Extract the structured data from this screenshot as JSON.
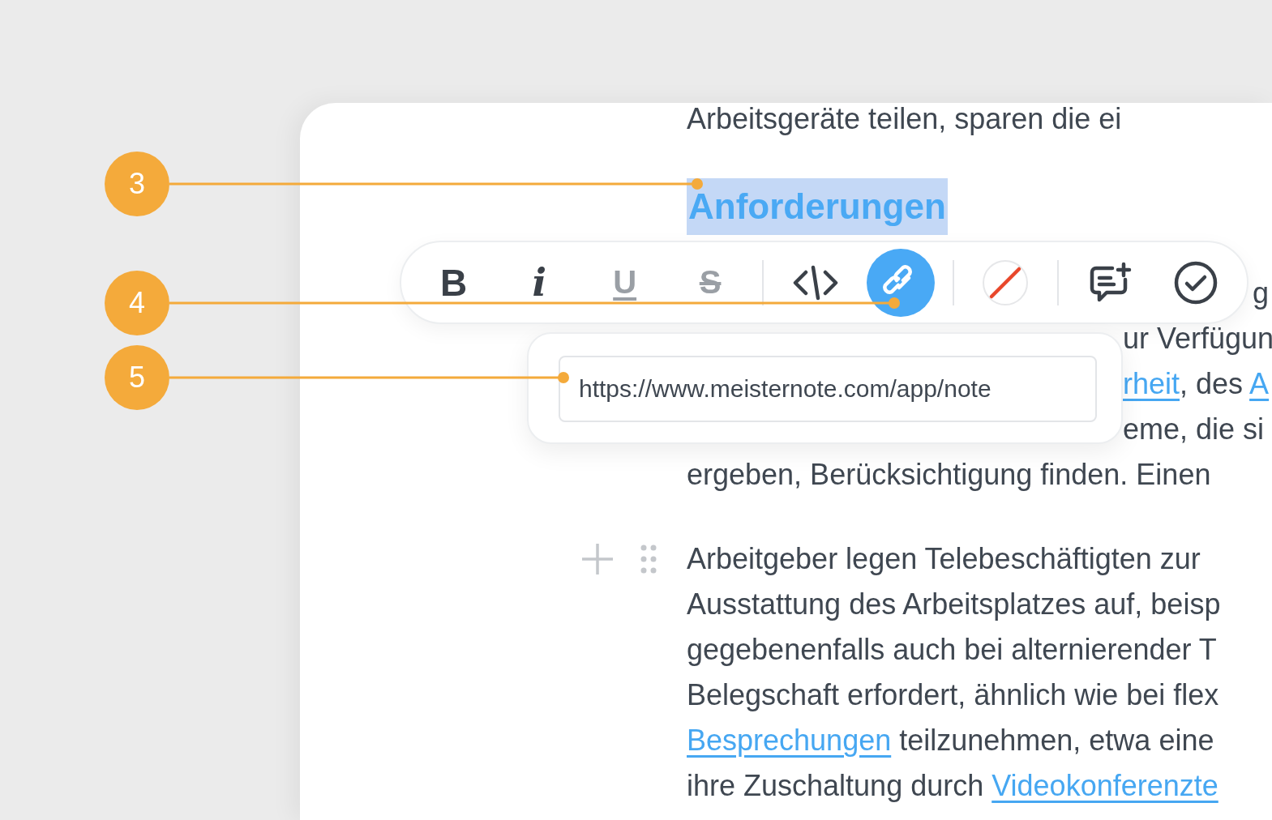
{
  "annotations": [
    {
      "number": "3"
    },
    {
      "number": "4"
    },
    {
      "number": "5"
    }
  ],
  "document": {
    "top_line": "Arbeitsgeräte teilen, sparen die ei",
    "heading": {
      "text": "Anforderungen",
      "selected": true
    },
    "paragraphs": [
      {
        "block_controls": false,
        "lines": [
          {
            "kind": "after-toolbar",
            "segments": [
              {
                "text": "g",
                "link": false
              }
            ]
          },
          {
            "kind": "after-popup",
            "segments": [
              {
                "text": "ur Verfügun",
                "link": false
              }
            ]
          },
          {
            "kind": "after-popup",
            "segments": [
              {
                "text": "rheit",
                "link": true
              },
              {
                "text": ", des ",
                "link": false
              },
              {
                "text": "A",
                "link": true
              }
            ]
          },
          {
            "kind": "after-popup",
            "segments": [
              {
                "text": "eme, die si",
                "link": false
              }
            ]
          },
          {
            "kind": "full",
            "segments": [
              {
                "text": "ergeben, Berücksichtigung finden. Einen",
                "link": false
              }
            ]
          }
        ]
      },
      {
        "block_controls": true,
        "lines": [
          {
            "kind": "full",
            "segments": [
              {
                "text": "Arbeitgeber legen Telebeschäftigten zur",
                "link": false
              }
            ]
          },
          {
            "kind": "full",
            "segments": [
              {
                "text": "Ausstattung des Arbeitsplatzes auf, beisp",
                "link": false
              }
            ]
          },
          {
            "kind": "full",
            "segments": [
              {
                "text": "gegebenenfalls auch bei alternierender T",
                "link": false
              }
            ]
          },
          {
            "kind": "full",
            "segments": [
              {
                "text": "Belegschaft erfordert, ähnlich wie bei flex",
                "link": false
              }
            ]
          },
          {
            "kind": "full",
            "segments": [
              {
                "text": "Besprechungen",
                "link": true
              },
              {
                "text": " teilzunehmen, etwa eine",
                "link": false
              }
            ]
          },
          {
            "kind": "full",
            "segments": [
              {
                "text": "ihre Zuschaltung durch ",
                "link": false
              },
              {
                "text": "Videokonferenzte",
                "link": true
              }
            ]
          }
        ]
      }
    ]
  },
  "toolbar": {
    "buttons": [
      {
        "kind": "bold",
        "label": "B",
        "selected": false,
        "disabled": false
      },
      {
        "kind": "italic",
        "label": "i",
        "selected": false,
        "disabled": false
      },
      {
        "kind": "underline",
        "label": "U",
        "selected": false,
        "disabled": true
      },
      {
        "kind": "strike",
        "label": "S",
        "selected": false,
        "disabled": true
      },
      {
        "kind": "code",
        "selected": false,
        "disabled": false
      },
      {
        "kind": "link",
        "selected": true,
        "disabled": false
      },
      {
        "kind": "color",
        "selected": false,
        "disabled": false
      },
      {
        "kind": "comment",
        "selected": false,
        "disabled": false
      },
      {
        "kind": "done",
        "selected": false,
        "disabled": false
      }
    ]
  },
  "link_popup": {
    "url": "https://www.meisternote.com/app/note"
  }
}
